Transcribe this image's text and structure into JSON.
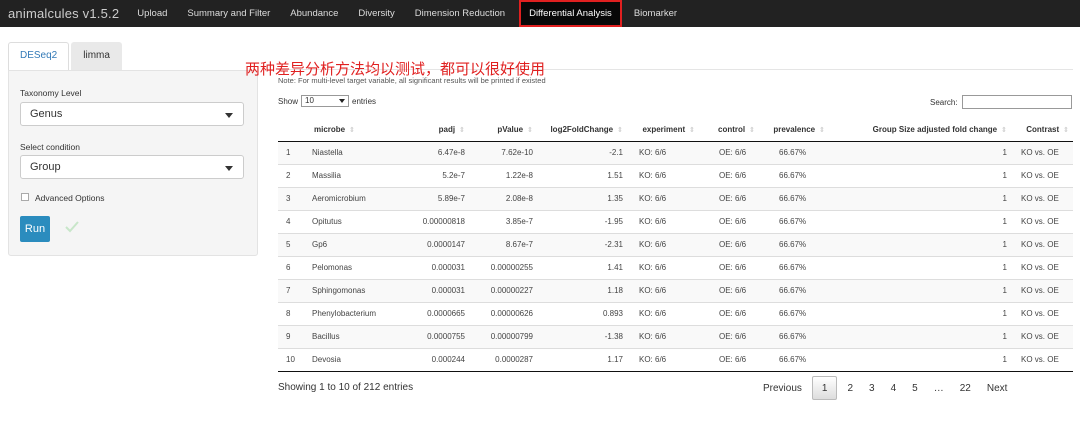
{
  "navbar": {
    "brand": "animalcules v1.5.2",
    "items": [
      "Upload",
      "Summary and Filter",
      "Abundance",
      "Diversity",
      "Dimension Reduction",
      "Differential Analysis",
      "Biomarker"
    ],
    "active": "Differential Analysis",
    "highlight_color": "#e02020"
  },
  "sidebar": {
    "tabs": [
      "DESeq2",
      "limma"
    ],
    "taxonomy_label": "Taxonomy Level",
    "taxonomy_value": "Genus",
    "condition_label": "Select condition",
    "condition_value": "Group",
    "advanced_label": "Advanced Options",
    "run_label": "Run",
    "run_color": "#2b8cbe"
  },
  "annotation": "两种差异分析方法均以测试，都可以很好使用",
  "note": "Note: For multi-level target variable, all significant results will be printed if existed",
  "table_controls": {
    "show_label": "Show",
    "show_value": "10",
    "entries_label": "entries",
    "search_label": "Search:"
  },
  "table": {
    "columns": [
      "",
      "microbe",
      "padj",
      "pValue",
      "log2FoldChange",
      "experiment",
      "control",
      "prevalence",
      "Group Size adjusted fold change",
      "Contrast"
    ],
    "rows": [
      [
        "1",
        "Niastella",
        "6.47e-8",
        "7.62e-10",
        "-2.1",
        "KO: 6/6",
        "OE: 6/6",
        "66.67%",
        "1",
        "KO vs. OE"
      ],
      [
        "2",
        "Massilia",
        "5.2e-7",
        "1.22e-8",
        "1.51",
        "KO: 6/6",
        "OE: 6/6",
        "66.67%",
        "1",
        "KO vs. OE"
      ],
      [
        "3",
        "Aeromicrobium",
        "5.89e-7",
        "2.08e-8",
        "1.35",
        "KO: 6/6",
        "OE: 6/6",
        "66.67%",
        "1",
        "KO vs. OE"
      ],
      [
        "4",
        "Opitutus",
        "0.00000818",
        "3.85e-7",
        "-1.95",
        "KO: 6/6",
        "OE: 6/6",
        "66.67%",
        "1",
        "KO vs. OE"
      ],
      [
        "5",
        "Gp6",
        "0.0000147",
        "8.67e-7",
        "-2.31",
        "KO: 6/6",
        "OE: 6/6",
        "66.67%",
        "1",
        "KO vs. OE"
      ],
      [
        "6",
        "Pelomonas",
        "0.000031",
        "0.00000255",
        "1.41",
        "KO: 6/6",
        "OE: 6/6",
        "66.67%",
        "1",
        "KO vs. OE"
      ],
      [
        "7",
        "Sphingomonas",
        "0.000031",
        "0.00000227",
        "1.18",
        "KO: 6/6",
        "OE: 6/6",
        "66.67%",
        "1",
        "KO vs. OE"
      ],
      [
        "8",
        "Phenylobacterium",
        "0.0000665",
        "0.00000626",
        "0.893",
        "KO: 6/6",
        "OE: 6/6",
        "66.67%",
        "1",
        "KO vs. OE"
      ],
      [
        "9",
        "Bacillus",
        "0.0000755",
        "0.00000799",
        "-1.38",
        "KO: 6/6",
        "OE: 6/6",
        "66.67%",
        "1",
        "KO vs. OE"
      ],
      [
        "10",
        "Devosia",
        "0.000244",
        "0.0000287",
        "1.17",
        "KO: 6/6",
        "OE: 6/6",
        "66.67%",
        "1",
        "KO vs. OE"
      ]
    ]
  },
  "footer": {
    "info": "Showing 1 to 10 of 212 entries",
    "pages": [
      "Previous",
      "1",
      "2",
      "3",
      "4",
      "5",
      "…",
      "22",
      "Next"
    ],
    "current_page": "1"
  }
}
